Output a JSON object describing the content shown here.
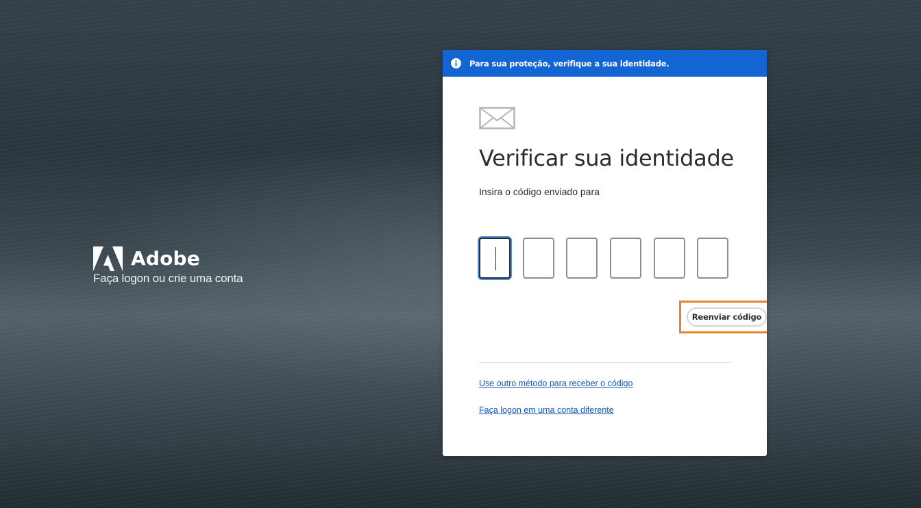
{
  "brand": {
    "name": "Adobe",
    "tagline": "Faça logon ou crie uma conta",
    "logo_icon": "adobe-logo-icon"
  },
  "banner": {
    "icon": "info-icon",
    "text": "Para sua proteção, verifique a sua identidade.",
    "color": "#1265d3"
  },
  "verify": {
    "icon": "envelope-icon",
    "title": "Verificar sua identidade",
    "instruction": "Insira o código enviado para",
    "code_inputs": [
      "",
      "",
      "",
      "",
      "",
      ""
    ],
    "active_input_index": 0,
    "resend_label": "Reenviar código",
    "highlight_color": "#e6842a"
  },
  "links": {
    "other_method": "Use outro método para receber o código",
    "different_account": "Faça logon em uma conta diferente"
  }
}
